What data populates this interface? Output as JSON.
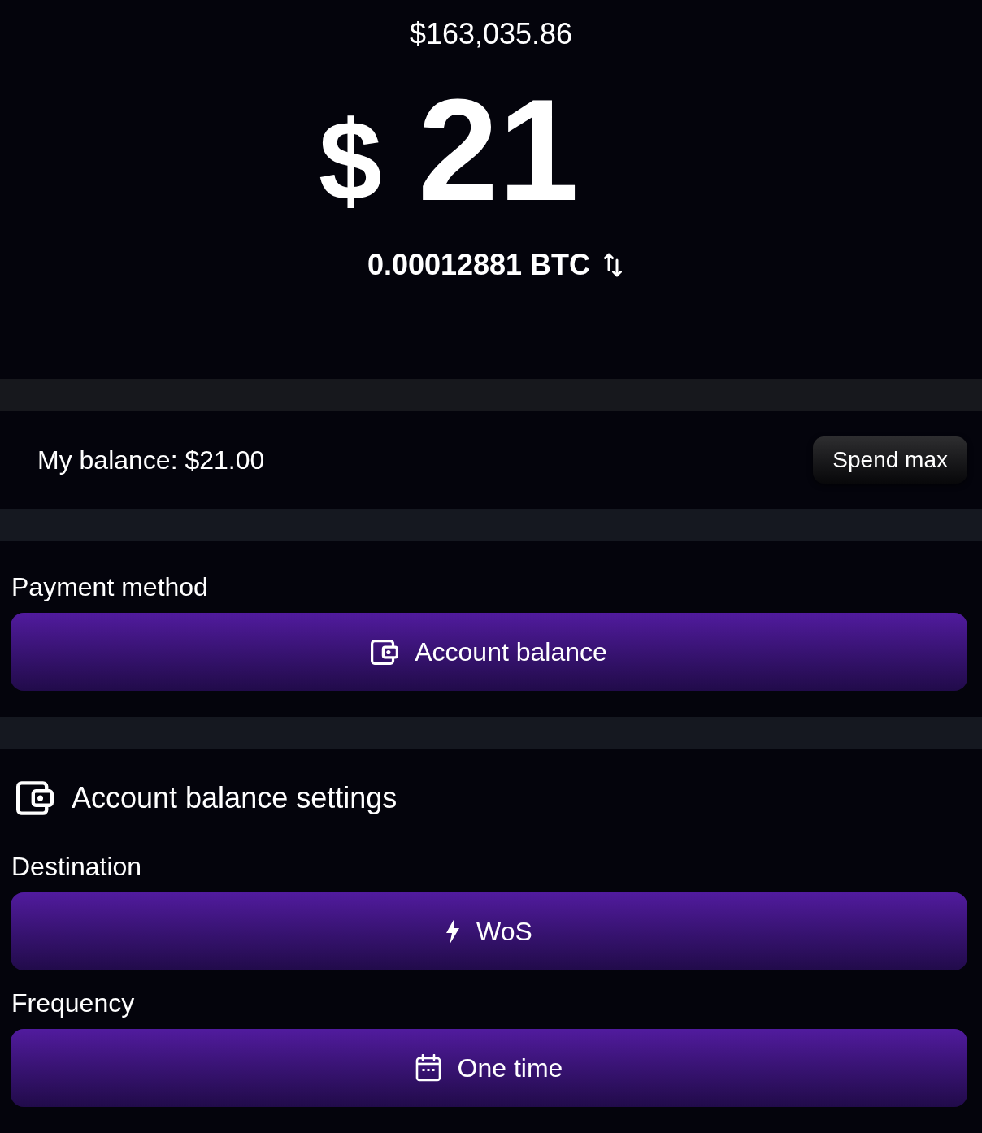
{
  "header": {
    "btc_price": "$163,035.86",
    "currency_symbol": "$",
    "amount": "21",
    "btc_amount": "0.00012881 BTC"
  },
  "balance": {
    "label": "My balance: $21.00",
    "button": "Spend max"
  },
  "payment_method": {
    "label": "Payment method",
    "button": "Account balance"
  },
  "settings": {
    "title": "Account balance settings",
    "fields": [
      {
        "label": "Destination",
        "value": "WoS"
      },
      {
        "label": "Frequency",
        "value": "One time"
      }
    ]
  }
}
